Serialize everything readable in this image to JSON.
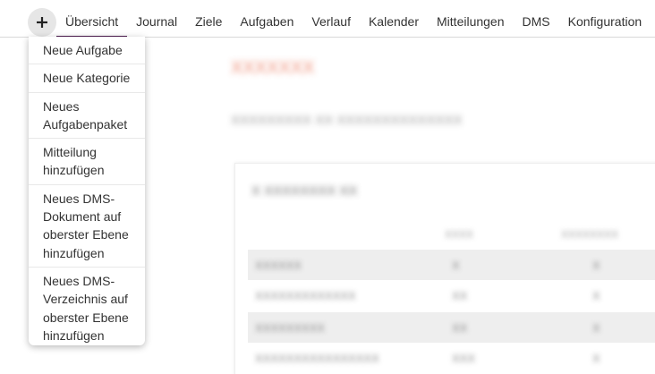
{
  "nav": {
    "add_label": "+",
    "tabs": [
      {
        "label": "Übersicht",
        "active": true
      },
      {
        "label": "Journal",
        "active": false
      },
      {
        "label": "Ziele",
        "active": false
      },
      {
        "label": "Aufgaben",
        "active": false
      },
      {
        "label": "Verlauf",
        "active": false
      },
      {
        "label": "Kalender",
        "active": false
      },
      {
        "label": "Mitteilungen",
        "active": false
      },
      {
        "label": "DMS",
        "active": false
      },
      {
        "label": "Konfiguration",
        "active": false
      }
    ],
    "accent_color": "#4b1a4f"
  },
  "dropdown": {
    "items": [
      "Neue Aufgabe",
      "Neue Kategorie",
      "Neues Aufgabenpaket",
      "Mitteilung hinzufügen",
      "Neues DMS-Dokument auf oberster Ebene hinzufügen",
      "Neues DMS-Verzeichnis auf oberster Ebene hinzufügen"
    ]
  },
  "main": {
    "title": "XXXXXXX",
    "subtitle": "XXXXXXXXX XX XXXXXXXXXXXXXX",
    "card": {
      "title": "X XXXXXXXX XX",
      "columns": [
        "XXXX",
        "XXXXXXXX"
      ],
      "rows": [
        {
          "name": "XXXXXX",
          "v1": "X",
          "v2": "X",
          "shaded": true
        },
        {
          "name": "XXXXXXXXXXXXX",
          "v1": "XX",
          "v2": "X",
          "shaded": false
        },
        {
          "name": "XXXXXXXXX",
          "v1": "XX",
          "v2": "X",
          "shaded": true
        },
        {
          "name": "XXXXXXXXXXXXXXXX",
          "v1": "XXX",
          "v2": "X",
          "shaded": false
        }
      ]
    }
  }
}
